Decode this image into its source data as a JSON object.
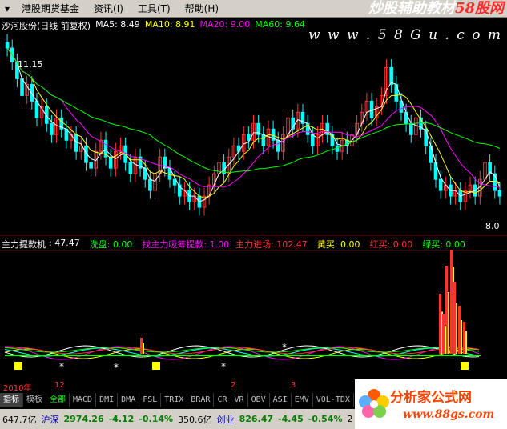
{
  "menubar": {
    "items": [
      "港股期货基金",
      "资讯(I)",
      "工具(T)",
      "帮助(H)"
    ],
    "sys_icon": "window-menu-icon"
  },
  "brand": {
    "part1": "炒股辅助教材",
    "part2": "58股网"
  },
  "website": "w w w . 5 8 G u . c o m",
  "info": {
    "stock": "沙河股份(日线 前复权)",
    "ma5": "MA5: 8.49",
    "ma10": "MA10: 8.91",
    "ma20": "MA20: 9.00",
    "ma60": "MA60: 9.64"
  },
  "price_labels": {
    "high": "11.15",
    "low": "8.0"
  },
  "indicator": {
    "name": "主力提款机",
    "value": ": 47.47",
    "wash": "洗盘: 0.00",
    "find": "找主力吸筹提款: 1.00",
    "enter": "主力进场: 102.47",
    "yellow_buy": "黄买: 0.00",
    "red_buy": "红买: 0.00",
    "green_buy": "绿买: 0.00"
  },
  "axis": [
    "2010年",
    "12",
    "2",
    "3"
  ],
  "tabs": [
    "指标",
    "模板",
    "全部",
    "MACD",
    "DMI",
    "DMA",
    "FSL",
    "TRIX",
    "BRAR",
    "CR",
    "VR",
    "OBV",
    "ASI",
    "EMV",
    "VOL-TDX"
  ],
  "status": {
    "amount1": "647.7亿",
    "index1": "沪深",
    "price1": "2974.26",
    "chg1": "-4.12",
    "pct1": "-0.14%",
    "amount2": "350.6亿",
    "index2": "创业",
    "price2": "826.47",
    "chg2": "-4.45",
    "pct2": "-0.54%",
    "tail": "2"
  },
  "logo2": {
    "title": "分析家公式网",
    "url": "www.88gs.com"
  },
  "colors": {
    "up": "#ff3232",
    "down": "#00ffff",
    "ma5": "#ffffff",
    "ma10": "#ffff00",
    "ma20": "#ff00ff",
    "ma60": "#00ff00"
  },
  "chart_data": {
    "type": "candlestick",
    "title": "沙河股份(日线 前复权)",
    "ylim": [
      8.0,
      11.15
    ],
    "x": [],
    "series": [
      {
        "name": "MA5",
        "values": [
          8.49
        ]
      },
      {
        "name": "MA10",
        "values": [
          8.91
        ]
      },
      {
        "name": "MA20",
        "values": [
          9.0
        ]
      },
      {
        "name": "MA60",
        "values": [
          9.64
        ]
      }
    ],
    "close": [
      11.15,
      10.9,
      10.6,
      10.3,
      10.5,
      10.2,
      9.9,
      10.1,
      9.8,
      9.6,
      9.9,
      9.7,
      9.5,
      9.6,
      9.3,
      9.4,
      9.1,
      9.0,
      9.3,
      9.5,
      9.2,
      9.0,
      9.3,
      9.4,
      9.1,
      8.9,
      9.2,
      9.0,
      8.8,
      8.6,
      8.9,
      9.2,
      9.0,
      8.8,
      8.7,
      8.5,
      8.6,
      8.4,
      8.5,
      8.3,
      8.5,
      8.7,
      8.9,
      9.1,
      8.9,
      9.2,
      9.4,
      9.3,
      9.6,
      9.5,
      9.8,
      9.6,
      9.4,
      9.7,
      9.5,
      9.3,
      9.6,
      9.9,
      9.7,
      10.0,
      9.8,
      9.6,
      9.4,
      9.6,
      9.8,
      9.6,
      9.4,
      9.3,
      9.5,
      9.4,
      9.6,
      9.8,
      10.0,
      10.2,
      9.9,
      10.1,
      10.3,
      10.8,
      10.5,
      10.2,
      10.0,
      9.8,
      9.6,
      9.9,
      9.7,
      9.4,
      9.1,
      8.8,
      8.6,
      8.7,
      8.5,
      8.6,
      8.4,
      8.6,
      8.7,
      8.5,
      8.8,
      9.1,
      8.9,
      8.6,
      8.5
    ]
  }
}
